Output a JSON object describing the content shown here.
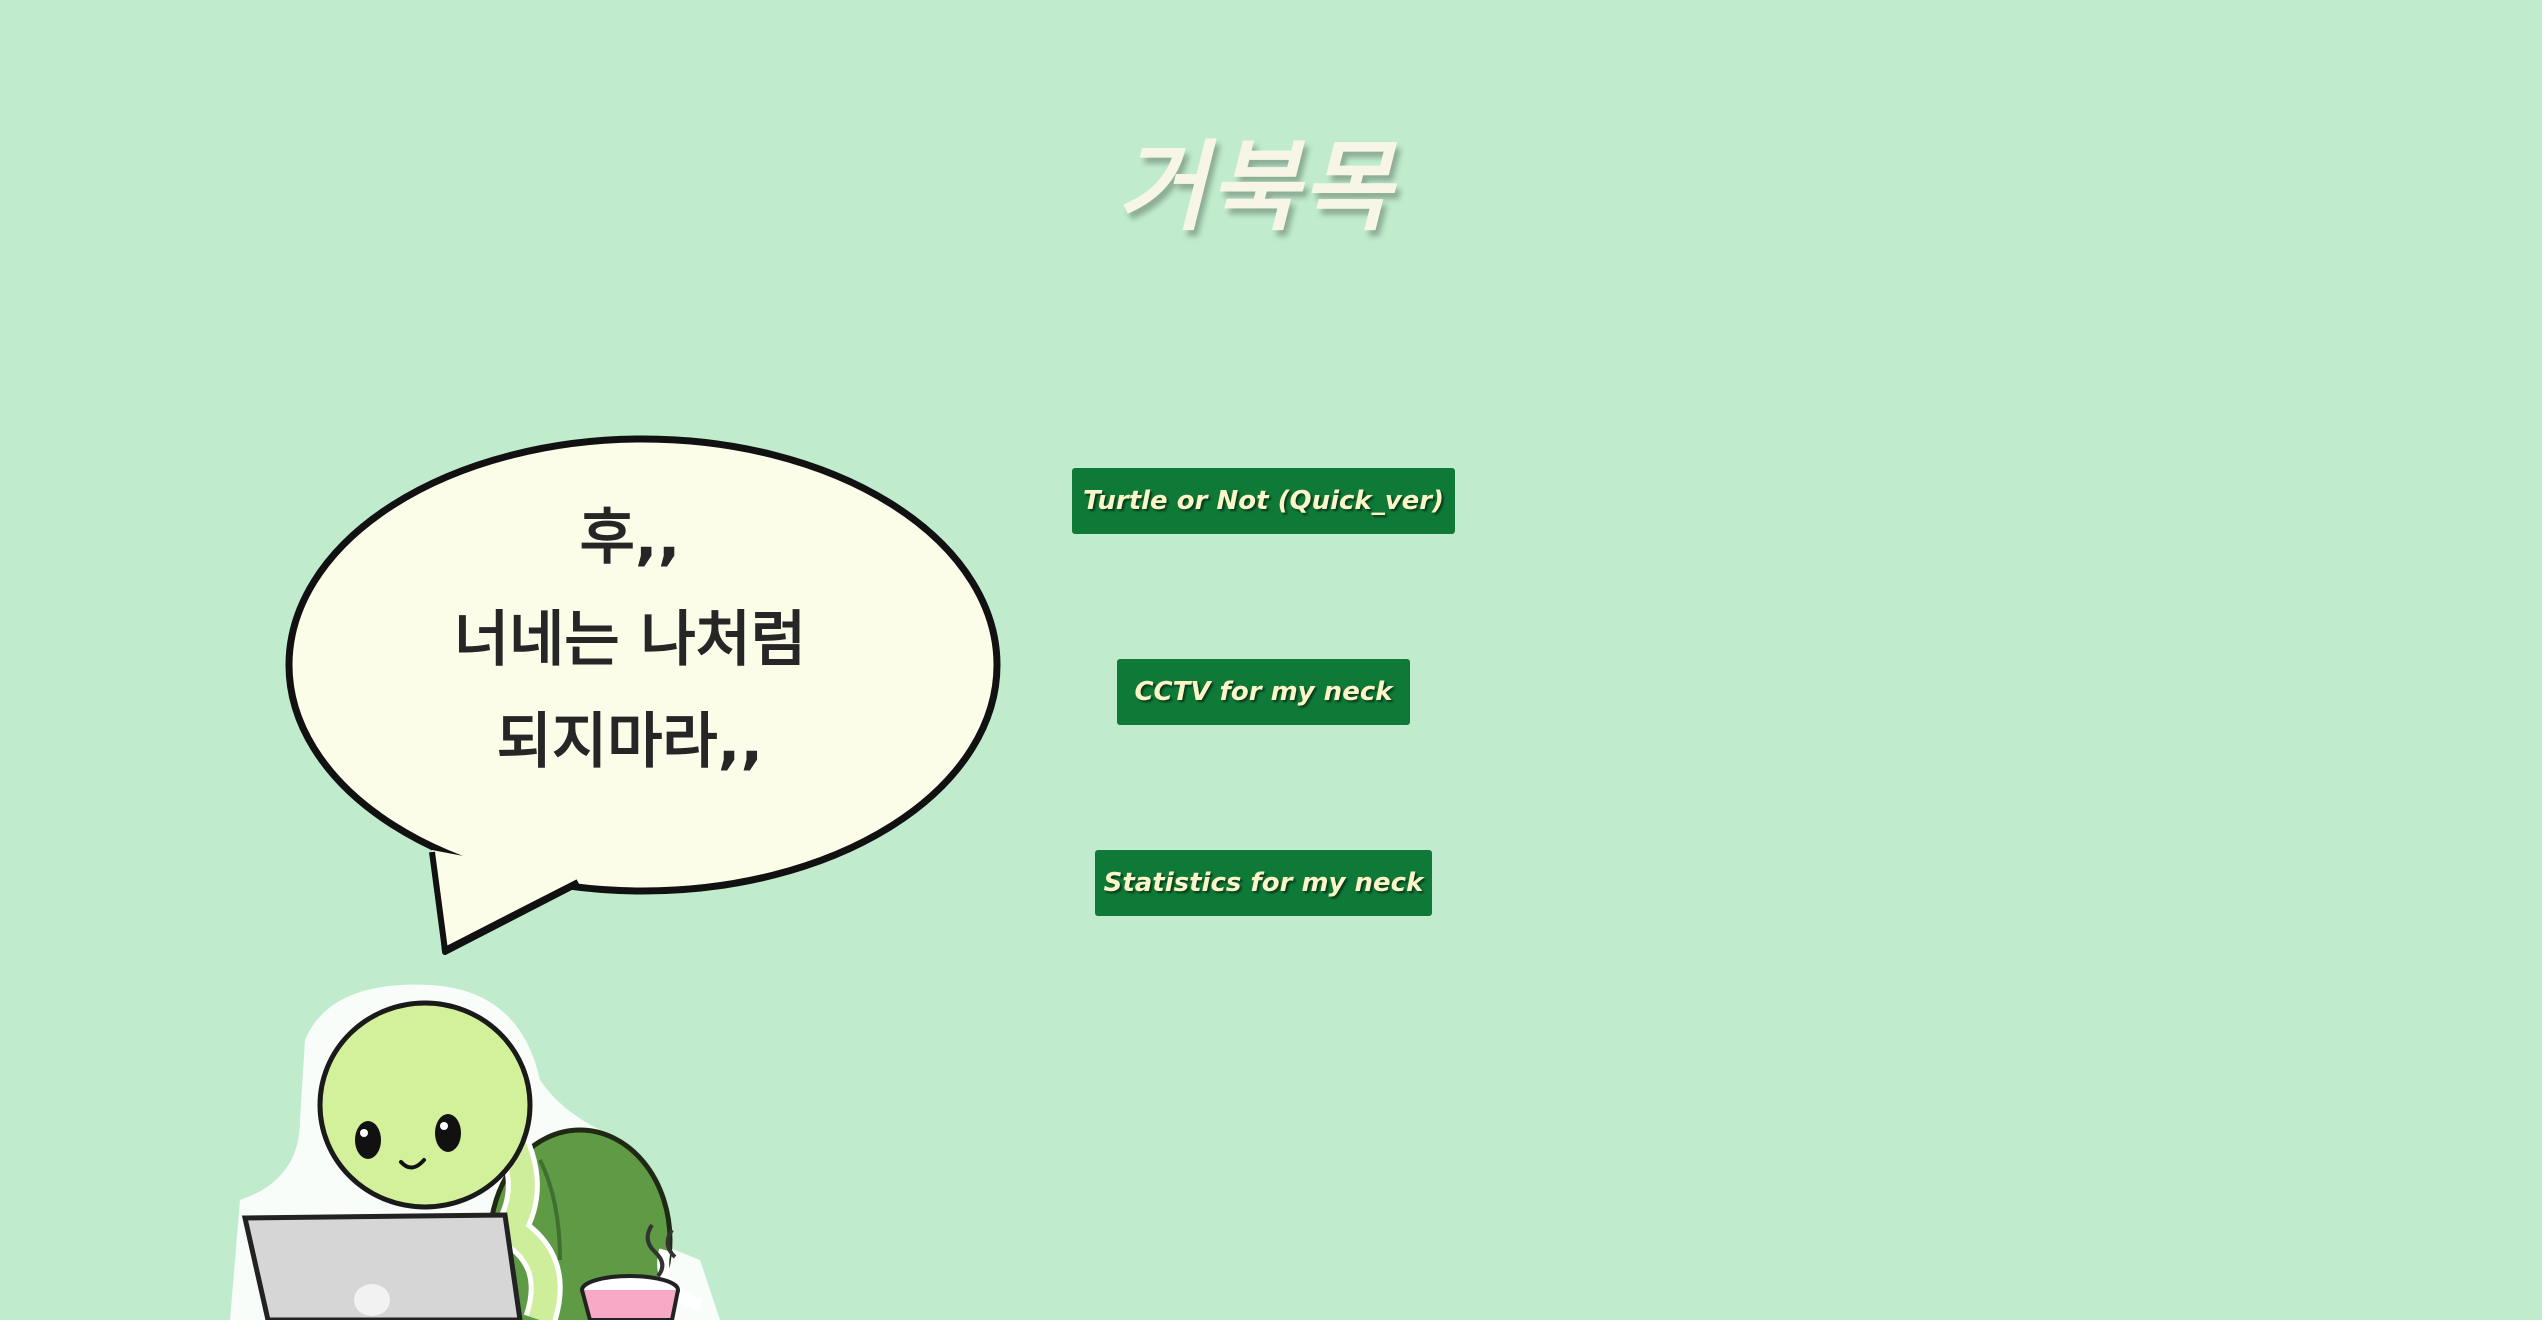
{
  "title": "거북목",
  "buttons": {
    "quick": "Turtle or Not (Quick_ver)",
    "cctv": "CCTV for my neck",
    "stats": "Statistics for my neck"
  },
  "bubble": {
    "line1": "후,,",
    "line2": "너네는 나처럼",
    "line3": "되지마라,,"
  },
  "colors": {
    "background": "#c0eccd",
    "button": "#0f7a38",
    "button_text": "#fbf6c8",
    "title": "#f7f6e6"
  }
}
